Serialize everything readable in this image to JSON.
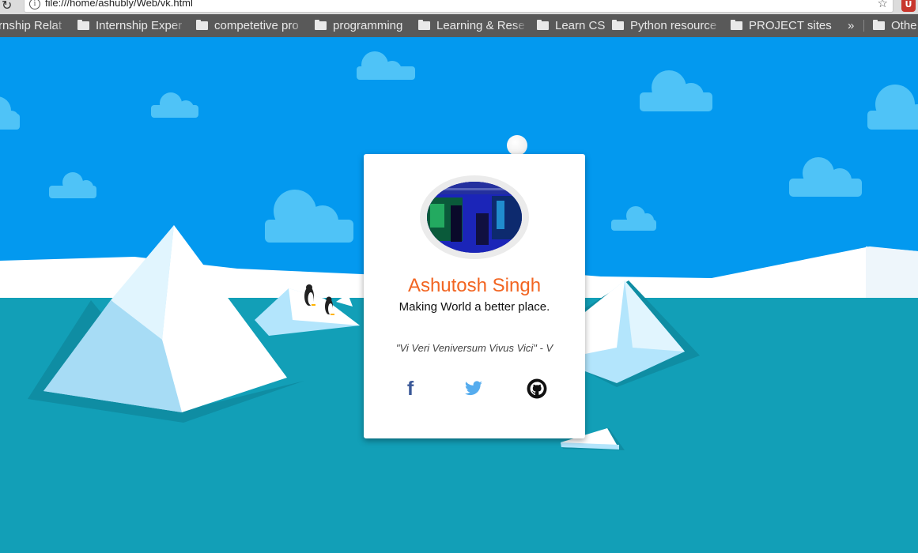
{
  "browser": {
    "url": "file:///home/ashubly/Web/vk.html",
    "bookmarks": [
      "rnship Relat",
      "Internship Exper",
      "competetive pro",
      "programming",
      "Learning & Rese",
      "Learn CS",
      "Python resource",
      "PROJECT sites",
      "Othe"
    ],
    "overflow_glyph": "»"
  },
  "profile": {
    "name": "Ashutosh Singh",
    "tagline": "Making World a better place.",
    "quote": "\"Vi Veri Veniversum Vivus Vici\" - V",
    "social": [
      "facebook-icon",
      "twitter-icon",
      "github-icon"
    ]
  },
  "colors": {
    "sky": "#0399ef",
    "sea": "#129fb7",
    "name": "#f26522",
    "facebook": "#3b5998",
    "twitter": "#55acee",
    "github": "#111111"
  }
}
